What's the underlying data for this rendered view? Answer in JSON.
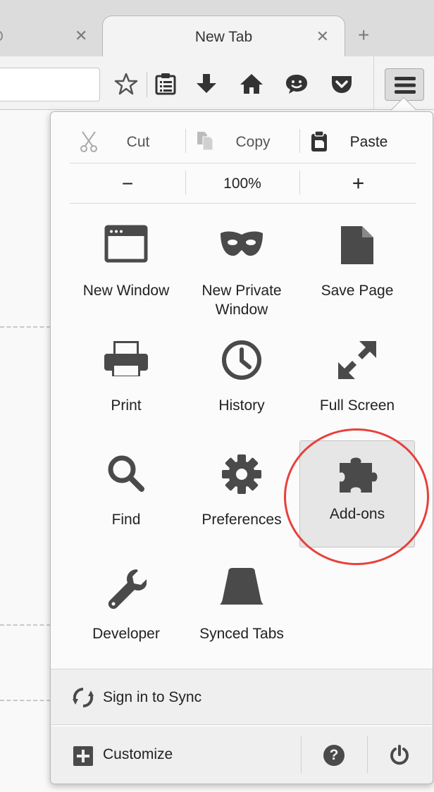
{
  "tabs": [
    {
      "title": "",
      "close": "✕"
    },
    {
      "title": "New Tab",
      "close": "✕",
      "active": true
    }
  ],
  "newtab": "+",
  "toolbar": {
    "icons": [
      "bookmark-star-icon",
      "reading-list-icon",
      "download-icon",
      "home-icon",
      "hello-chat-icon",
      "pocket-icon",
      "hamburger-menu-icon"
    ]
  },
  "menu": {
    "edit": {
      "cut": "Cut",
      "copy": "Copy",
      "paste": "Paste"
    },
    "zoom": {
      "minus": "−",
      "level": "100%",
      "plus": "+"
    },
    "grid": [
      {
        "label": "New Window",
        "icon": "window-icon"
      },
      {
        "label": "New Private\nWindow",
        "icon": "private-mask-icon"
      },
      {
        "label": "Save Page",
        "icon": "page-icon"
      },
      {
        "label": "Print",
        "icon": "printer-icon"
      },
      {
        "label": "History",
        "icon": "clock-icon"
      },
      {
        "label": "Full Screen",
        "icon": "fullscreen-arrows-icon"
      },
      {
        "label": "Find",
        "icon": "magnifier-icon"
      },
      {
        "label": "Preferences",
        "icon": "gear-icon"
      },
      {
        "label": "Add-ons",
        "icon": "puzzle-icon"
      },
      {
        "label": "Developer",
        "icon": "wrench-icon"
      },
      {
        "label": "Synced Tabs",
        "icon": "synced-tabs-icon"
      }
    ],
    "sync": "Sign in to Sync",
    "customize": "Customize",
    "help": "?",
    "colors": {
      "highlight_ring": "#e8403c",
      "icon": "#4a4a4a"
    }
  }
}
